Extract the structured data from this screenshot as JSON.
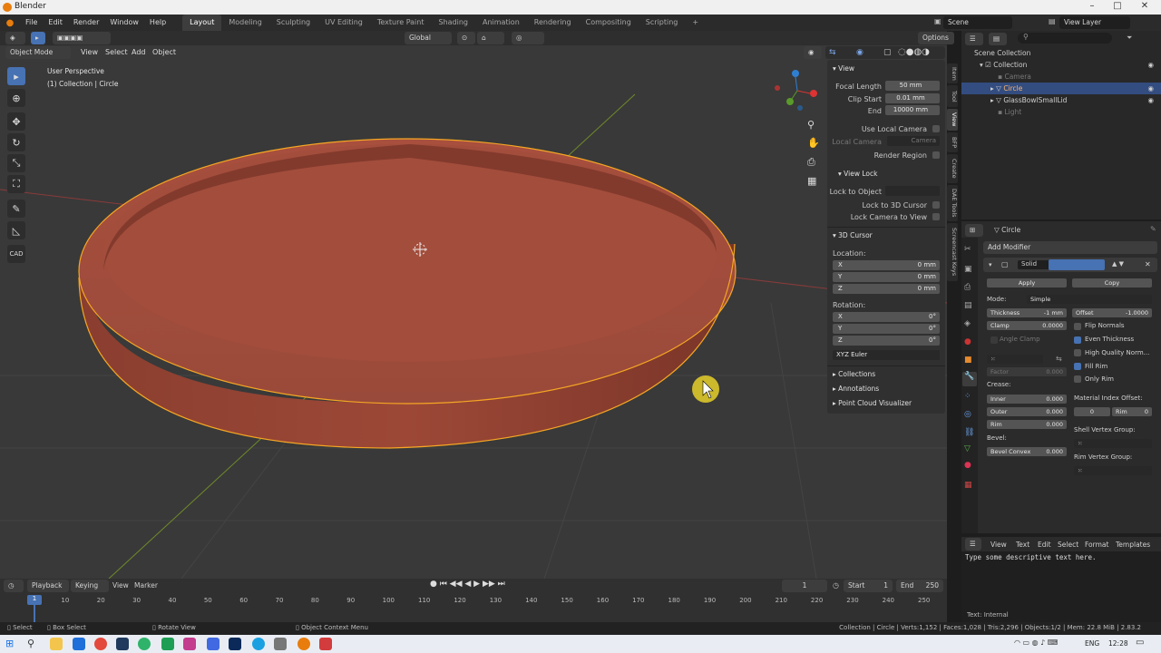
{
  "titlebar": {
    "title": "Blender",
    "min": "–",
    "max": "□",
    "close": "✕"
  },
  "menu": {
    "items": [
      "File",
      "Edit",
      "Render",
      "Window",
      "Help"
    ]
  },
  "workspaces": [
    "Layout",
    "Modeling",
    "Sculpting",
    "UV Editing",
    "Texture Paint",
    "Shading",
    "Animation",
    "Rendering",
    "Compositing",
    "Scripting"
  ],
  "active_workspace": "Layout",
  "scene": {
    "label": "Scene",
    "view_layer": "View Layer"
  },
  "viewport": {
    "transform_orientation": "Global",
    "options_label": "Options",
    "mode": "Object Mode",
    "header_menu": [
      "View",
      "Select",
      "Add",
      "Object"
    ],
    "overlay_text_1": "User Perspective",
    "overlay_text_2": "(1) Collection | Circle"
  },
  "npanel": {
    "tabs": [
      "Item",
      "Tool",
      "View",
      "BFP",
      "Create",
      "DAE Tools",
      "Screencast Keys"
    ],
    "view_header": "View",
    "focal_length_label": "Focal Length",
    "focal_length": "50 mm",
    "clip_start_label": "Clip Start",
    "clip_start": "0.01 mm",
    "end_label": "End",
    "end": "10000 mm",
    "use_local_camera": "Use Local Camera",
    "local_camera": "Local Camera",
    "camera": "Camera",
    "render_region": "Render Region",
    "view_lock_header": "View Lock",
    "lock_to_object": "Lock to Object",
    "lock_to_3d_cursor": "Lock to 3D Cursor",
    "lock_camera_to_view": "Lock Camera to View",
    "cursor_header": "3D Cursor",
    "location_label": "Location:",
    "loc_x": "0 mm",
    "loc_y": "0 mm",
    "loc_z": "0 mm",
    "rotation_label": "Rotation:",
    "rot_x": "0°",
    "rot_y": "0°",
    "rot_z": "0°",
    "axis_x": "X",
    "axis_y": "Y",
    "axis_z": "Z",
    "rotation_mode": "XYZ Euler",
    "collections": "Collections",
    "annotations": "Annotations",
    "point_cloud": "Point Cloud Visualizer"
  },
  "outliner": {
    "root": "Scene Collection",
    "items": [
      {
        "label": "Collection"
      },
      {
        "label": "Camera"
      },
      {
        "label": "Circle"
      },
      {
        "label": "GlassBowlSmallLid"
      },
      {
        "label": "Light"
      }
    ]
  },
  "properties": {
    "object_name": "Circle",
    "add_modifier": "Add Modifier",
    "modifier_name": "Solid",
    "apply": "Apply",
    "copy": "Copy",
    "mode_label": "Mode:",
    "mode_value": "Simple",
    "thickness_label": "Thickness",
    "thickness_value": "-1 mm",
    "offset_label": "Offset",
    "offset_value": "-1.0000",
    "clamp_label": "Clamp",
    "clamp_value": "0.0000",
    "angle_clamp": "Angle Clamp",
    "flip_normals": "Flip Normals",
    "even_thickness": "Even Thickness",
    "high_quality": "High Quality Norm...",
    "fill_rim": "Fill Rim",
    "only_rim": "Only Rim",
    "factor_label": "Factor",
    "factor_value": "0.000",
    "crease_label": "Crease:",
    "inner_label": "Inner",
    "inner_value": "0.000",
    "outer_label": "Outer",
    "outer_value": "0.000",
    "rim_label": "Rim",
    "rim_value": "0.000",
    "material_index": "Material Index Offset:",
    "mat_a": "0",
    "mat_rim_label": "Rim",
    "mat_b": "0",
    "bevel_label": "Bevel:",
    "bevel_convex_label": "Bevel Convex",
    "bevel_convex_value": "0.000",
    "shell_vg": "Shell Vertex Group:",
    "rim_vg": "Rim Vertex Group:"
  },
  "texteditor": {
    "menu": [
      "View",
      "Text",
      "Edit",
      "Select",
      "Format",
      "Templates"
    ],
    "content": "Type some descriptive text here.",
    "footer": "Text: Internal"
  },
  "timeline": {
    "menu": [
      "Playback",
      "Keying",
      "View",
      "Marker"
    ],
    "current_frame": "1",
    "start_label": "Start",
    "start": "1",
    "end_label": "End",
    "end": "250",
    "ticks": [
      "1",
      "10",
      "20",
      "30",
      "40",
      "50",
      "60",
      "70",
      "80",
      "90",
      "100",
      "110",
      "120",
      "130",
      "140",
      "150",
      "160",
      "170",
      "180",
      "190",
      "200",
      "210",
      "220",
      "230",
      "240",
      "250"
    ]
  },
  "statusbar": {
    "select": "Select",
    "box_select": "Box Select",
    "rotate_view": "Rotate View",
    "context_menu": "Object Context Menu",
    "stats": "Collection | Circle | Verts:1,152 | Faces:1,028 | Tris:2,296 | Objects:1/2 | Mem: 22.8 MiB | 2.83.2"
  },
  "taskbar": {
    "lang": "ENG",
    "time": "12:28"
  },
  "colors": {
    "accent": "#4772b3",
    "object": "#b0543e",
    "outline": "#f5a623",
    "selected_row": "#334d80"
  }
}
